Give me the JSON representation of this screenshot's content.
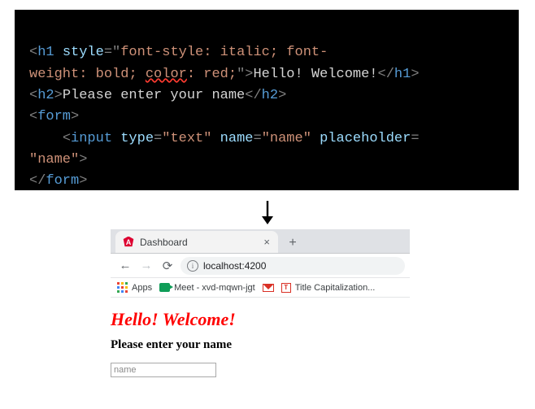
{
  "code": {
    "line1": {
      "open_punc": "<",
      "tag": "h1",
      "attr_name": "style",
      "eq_open": "=\"",
      "style_a": "font-style",
      "colon1": ": ",
      "style_a_val": "italic",
      "semi1": "; ",
      "style_b": "font-"
    },
    "line2": {
      "style_b2": "weight",
      "colon2": ": ",
      "style_b_val": "bold",
      "semi2": "; ",
      "style_c": "color",
      "colon3": ": ",
      "style_c_val": "red",
      "semi3": ";",
      "close_q": "\"",
      "gt": ">",
      "text": "Hello! Welcome!",
      "close_open": "</",
      "tag": "h1",
      "close_gt": ">"
    },
    "line3": {
      "open_punc": "<",
      "tag": "h2",
      "gt": ">",
      "text": "Please enter your name",
      "close_open": "</",
      "tag2": "h2",
      "close_gt": ">"
    },
    "line4": {
      "open_punc": "<",
      "tag": "form",
      "gt": ">"
    },
    "line5": {
      "indent": "    ",
      "open_punc": "<",
      "tag": "input",
      "attr1": "type",
      "eq1": "=",
      "val1": "\"text\"",
      "attr2": "name",
      "eq2": "=",
      "val2": "\"name\"",
      "attr3": "placeholder",
      "eq3": "="
    },
    "line6": {
      "val3": "\"name\"",
      "gt": ">"
    },
    "line7": {
      "open_punc": "</",
      "tag": "form",
      "gt": ">"
    }
  },
  "browser": {
    "tab": {
      "favicon_letter": "A",
      "title": "Dashboard"
    },
    "url": "localhost:4200",
    "bookmarks": {
      "apps": "Apps",
      "meet": "Meet - xvd-mqwn-jgt",
      "gmail": "M",
      "titlecap_icon": "T",
      "titlecap": "Title Capitalization..."
    }
  },
  "rendered": {
    "h1": "Hello! Welcome!",
    "h2": "Please enter your name",
    "input_placeholder": "name"
  }
}
